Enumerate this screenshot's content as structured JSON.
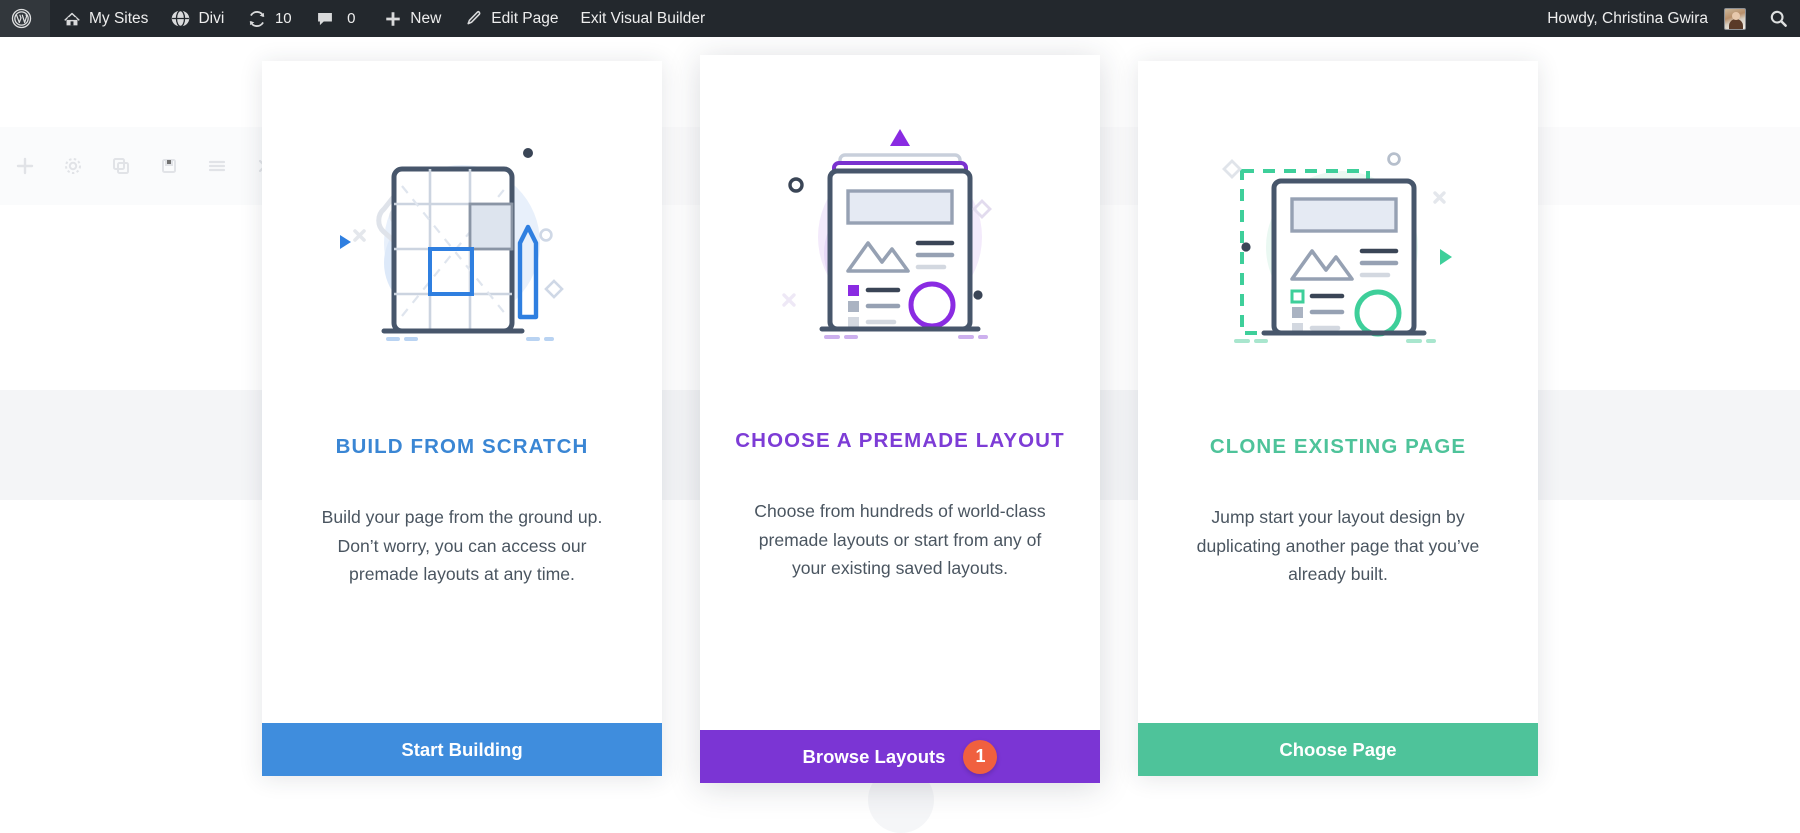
{
  "adminbar": {
    "left_items": [
      {
        "icon": "wordpress-logo-icon",
        "label": ""
      },
      {
        "icon": "my-sites-icon",
        "label": "My Sites"
      },
      {
        "icon": "divi-icon",
        "label": "Divi"
      },
      {
        "icon": "updates-icon",
        "label": "10"
      },
      {
        "icon": "comments-icon",
        "label": "0"
      },
      {
        "icon": "plus-icon",
        "label": "New"
      },
      {
        "icon": "pencil-icon",
        "label": "Edit Page"
      },
      {
        "icon": "",
        "label": "Exit Visual Builder"
      }
    ],
    "howdy": "Howdy, Christina Gwira",
    "avatar_name": "user-avatar",
    "search_icon": "search-icon"
  },
  "modal": {
    "cards": [
      {
        "id": "build-from-scratch",
        "illustration": "blueprint-wrench-illustration",
        "title": "BUILD FROM SCRATCH",
        "title_color": "#3a86d4",
        "description": "Build your page from the ground up. Don’t worry, you can access our premade layouts at any time.",
        "button_label": "Start Building",
        "button_color": "#3f8ddd",
        "badge": null
      },
      {
        "id": "choose-premade-layout",
        "illustration": "premade-layout-illustration",
        "title": "CHOOSE A PREMADE LAYOUT",
        "title_color": "#7d3cd6",
        "description": "Choose from hundreds of world-class premade layouts or start from any of your existing saved layouts.",
        "button_label": "Browse Layouts",
        "button_color": "#7b35d4",
        "badge": "1"
      },
      {
        "id": "clone-existing-page",
        "illustration": "clone-page-illustration",
        "title": "CLONE EXISTING PAGE",
        "title_color": "#4ec39a",
        "description": "Jump start your layout design by duplicating another page that you’ve already built.",
        "button_label": "Choose Page",
        "button_color": "#4ec39a",
        "badge": null
      }
    ]
  },
  "colors": {
    "adminbar_bg": "#23282d",
    "page_bg": "#ffffff",
    "card_bg": "#ffffff",
    "badge_bg": "#f0603f",
    "body_text": "#4a5560"
  }
}
